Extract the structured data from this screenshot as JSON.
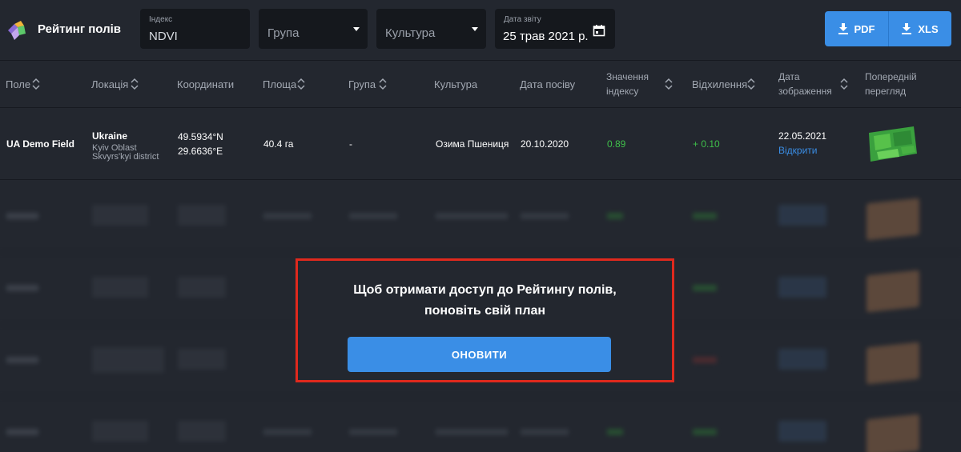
{
  "header": {
    "brand": "Рейтинг полів",
    "index": {
      "label": "Індекс",
      "value": "NDVI"
    },
    "group": {
      "value": "Група"
    },
    "crop": {
      "value": "Культура"
    },
    "report_date": {
      "label": "Дата звіту",
      "value": "25 трав 2021 р."
    },
    "export": {
      "pdf_label": "PDF",
      "xls_label": "XLS"
    }
  },
  "table": {
    "columns": {
      "field": "Поле",
      "location": "Локація",
      "coordinates": "Координати",
      "area": "Площа",
      "group": "Група",
      "crop": "Культура",
      "sowing_date": "Дата посіву",
      "index_value_1": "Значення",
      "index_value_2": "індексу",
      "deviation": "Відхилення",
      "image_date_1": "Дата",
      "image_date_2": "зображення",
      "preview_1": "Попередній",
      "preview_2": "перегляд"
    },
    "row": {
      "field": "UA Demo Field",
      "country": "Ukraine",
      "oblast": "Kyiv Oblast",
      "district": "Skvyrs'kyi district",
      "lat": "49.5934°N",
      "lon": "29.6636°E",
      "area": "40.4 га",
      "group": "-",
      "crop": "Озима Пшениця",
      "sowing_date": "20.10.2020",
      "index_value": "0.89",
      "deviation": "+ 0.10",
      "image_date": "22.05.2021",
      "open_link": "Відкрити"
    }
  },
  "paywall": {
    "line1": "Щоб отримати доступ до Рейтингу полів,",
    "line2": "поновіть свій план",
    "button": "ОНОВИТИ"
  },
  "colors": {
    "accent": "#3a8ee6",
    "highlight_border": "#e0291d",
    "positive": "#3fbf4a",
    "background": "#23272f"
  }
}
